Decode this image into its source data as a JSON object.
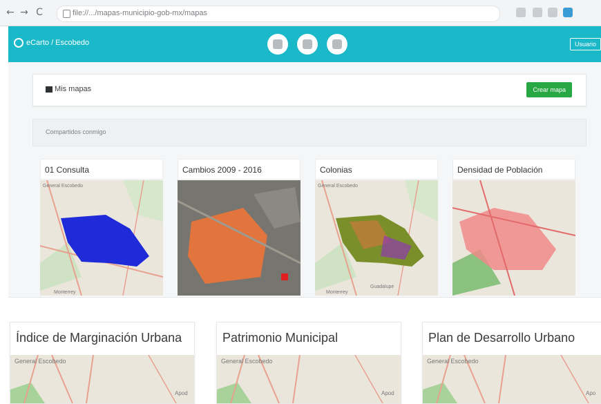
{
  "browser": {
    "url": "file://.../mapas-municipio-gob-mx/mapas",
    "nav_back": "←",
    "nav_forward": "→",
    "nav_reload": "C"
  },
  "app": {
    "brand": "eCarto / Escobedo",
    "user_label": "Usuario",
    "accent": "#1ab8c9"
  },
  "my_maps": {
    "title": "Mis mapas",
    "new_button": "Crear mapa"
  },
  "shared": {
    "title": "Compartidos conmigo"
  },
  "cards": [
    {
      "title": "01 Consulta",
      "map_label": "General Escobedo",
      "map_label2": "Monterrey"
    },
    {
      "title": "Cambios 2009 - 2016"
    },
    {
      "title": "Colonias",
      "map_label": "General Escobedo",
      "map_label2": "Monterrey",
      "map_label3": "Guadalupe"
    },
    {
      "title": "Densidad de Población"
    }
  ],
  "public_maps": [
    {
      "title": "Índice de Marginación Urbana",
      "map_label": "General Escobedo",
      "map_label2": "Apod"
    },
    {
      "title": "Patrimonio Municipal",
      "map_label": "General Escobedo",
      "map_label2": "Apod"
    },
    {
      "title": "Plan de Desarrollo Urbano",
      "map_label": "General Escobedo",
      "map_label2": "Apo"
    }
  ]
}
